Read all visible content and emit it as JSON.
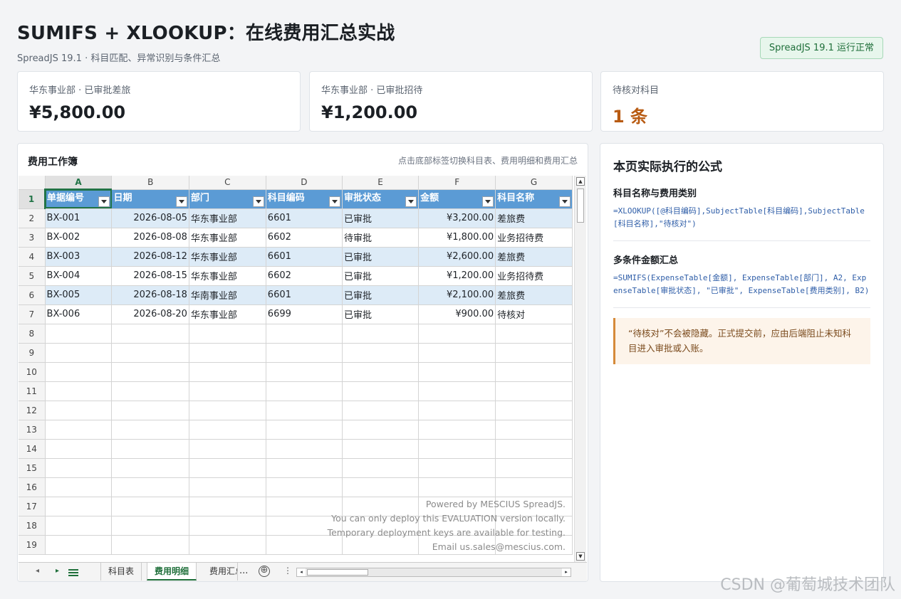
{
  "header": {
    "title": "SUMIFS + XLOOKUP：在线费用汇总实战",
    "subtitle": "SpreadJS 19.1 · 科目匹配、异常识别与条件汇总",
    "status_badge": "SpreadJS 19.1 运行正常"
  },
  "kpis": [
    {
      "label": "华东事业部 · 已审批差旅",
      "value": "¥5,800.00"
    },
    {
      "label": "华东事业部 · 已审批招待",
      "value": "¥1,200.00"
    },
    {
      "label": "待核对科目",
      "value": "1 条"
    }
  ],
  "workbook": {
    "title": "费用工作簿",
    "hint": "点击底部标签切换科目表、费用明细和费用汇总",
    "columns": [
      "A",
      "B",
      "C",
      "D",
      "E",
      "F",
      "G"
    ],
    "row_numbers": [
      "1",
      "2",
      "3",
      "4",
      "5",
      "6",
      "7",
      "8",
      "9",
      "10",
      "11",
      "12",
      "13",
      "14",
      "15",
      "16",
      "17",
      "18",
      "19"
    ],
    "table_headers": [
      "单据编号",
      "日期",
      "部门",
      "科目编码",
      "审批状态",
      "金额",
      "科目名称"
    ],
    "rows": [
      [
        "BX-001",
        "2026-08-05",
        "华东事业部",
        "6601",
        "已审批",
        "¥3,200.00",
        "差旅费"
      ],
      [
        "BX-002",
        "2026-08-08",
        "华东事业部",
        "6602",
        "待审批",
        "¥1,800.00",
        "业务招待费"
      ],
      [
        "BX-003",
        "2026-08-12",
        "华东事业部",
        "6601",
        "已审批",
        "¥2,600.00",
        "差旅费"
      ],
      [
        "BX-004",
        "2026-08-15",
        "华东事业部",
        "6602",
        "已审批",
        "¥1,200.00",
        "业务招待费"
      ],
      [
        "BX-005",
        "2026-08-18",
        "华南事业部",
        "6601",
        "已审批",
        "¥2,100.00",
        "差旅费"
      ],
      [
        "BX-006",
        "2026-08-20",
        "华东事业部",
        "6699",
        "已审批",
        "¥900.00",
        "待核对"
      ]
    ],
    "watermark_lines": [
      "Powered by MESCIUS SpreadJS.",
      "You can only deploy this EVALUATION version locally.",
      "Temporary deployment keys are available for testing.",
      "Email us.sales@mescius.com."
    ],
    "sheet_tabs": [
      "科目表",
      "费用明细",
      "费用汇总"
    ],
    "active_tab": "费用明细",
    "more_tabs": "...",
    "add_sheet": "⊕",
    "tab_menu": "⋮"
  },
  "formula_panel": {
    "title": "本页实际执行的公式",
    "sections": [
      {
        "title": "科目名称与费用类别",
        "code": "=XLOOKUP([@科目编码],SubjectTable[科目编码],SubjectTable[科目名称],\"待核对\")"
      },
      {
        "title": "多条件金额汇总",
        "code": "=SUMIFS(ExpenseTable[金额], ExpenseTable[部门], A2, ExpenseTable[审批状态], \"已审批\", ExpenseTable[费用类别], B2)"
      }
    ],
    "note": "“待核对”不会被隐藏。正式提交前，应由后端阻止未知科目进入审批或入账。"
  },
  "page_watermark": "CSDN @葡萄城技术团队",
  "colors": {
    "accent": "#217346",
    "table_header": "#5b9bd5",
    "band": "#ddebf7",
    "warn": "#b85b12"
  }
}
